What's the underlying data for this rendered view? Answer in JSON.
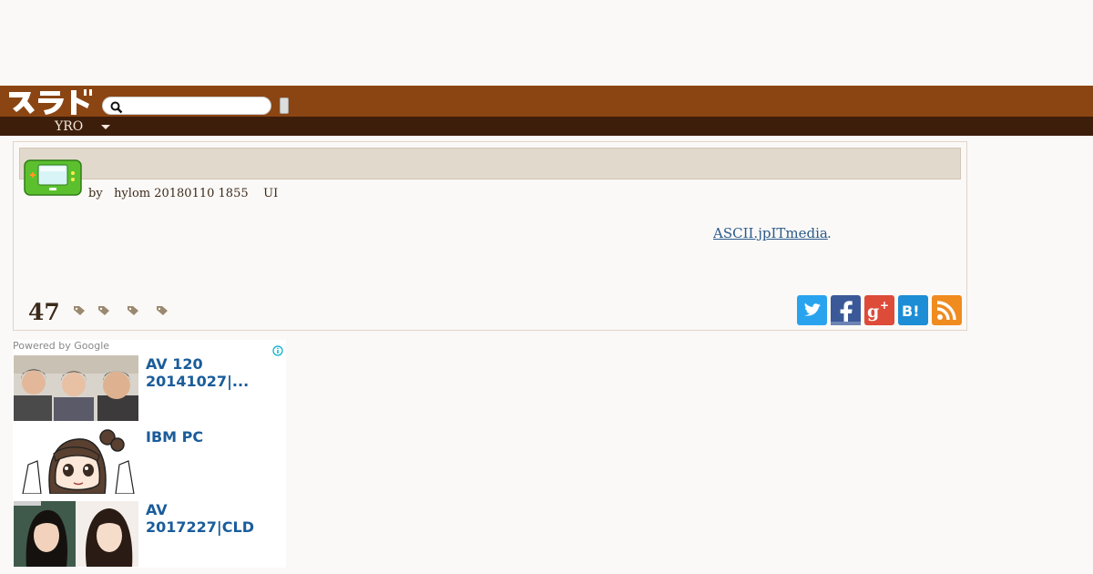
{
  "header": {
    "logo_text": "スラド",
    "search_placeholder": "",
    "search_button_label": ""
  },
  "nav": {
    "section_label": "YRO"
  },
  "story": {
    "title": "",
    "byline": "by   hylom 20180110 1855    UI",
    "source_link": "ASCII.jpITmedia",
    "source_suffix": ".",
    "comment_count": "47"
  },
  "ads": {
    "powered_by": "Powered by Google",
    "items": [
      {
        "line1": "AV 120",
        "line2": "20141027|..."
      },
      {
        "line1": "IBM PC",
        "line2": ""
      },
      {
        "line1": " AV",
        "line2": "2017227|CLD"
      }
    ]
  },
  "colors": {
    "header_brown": "#8b4513",
    "subbar_dark": "#3d1e0b",
    "link_blue": "#2a5a8a"
  }
}
